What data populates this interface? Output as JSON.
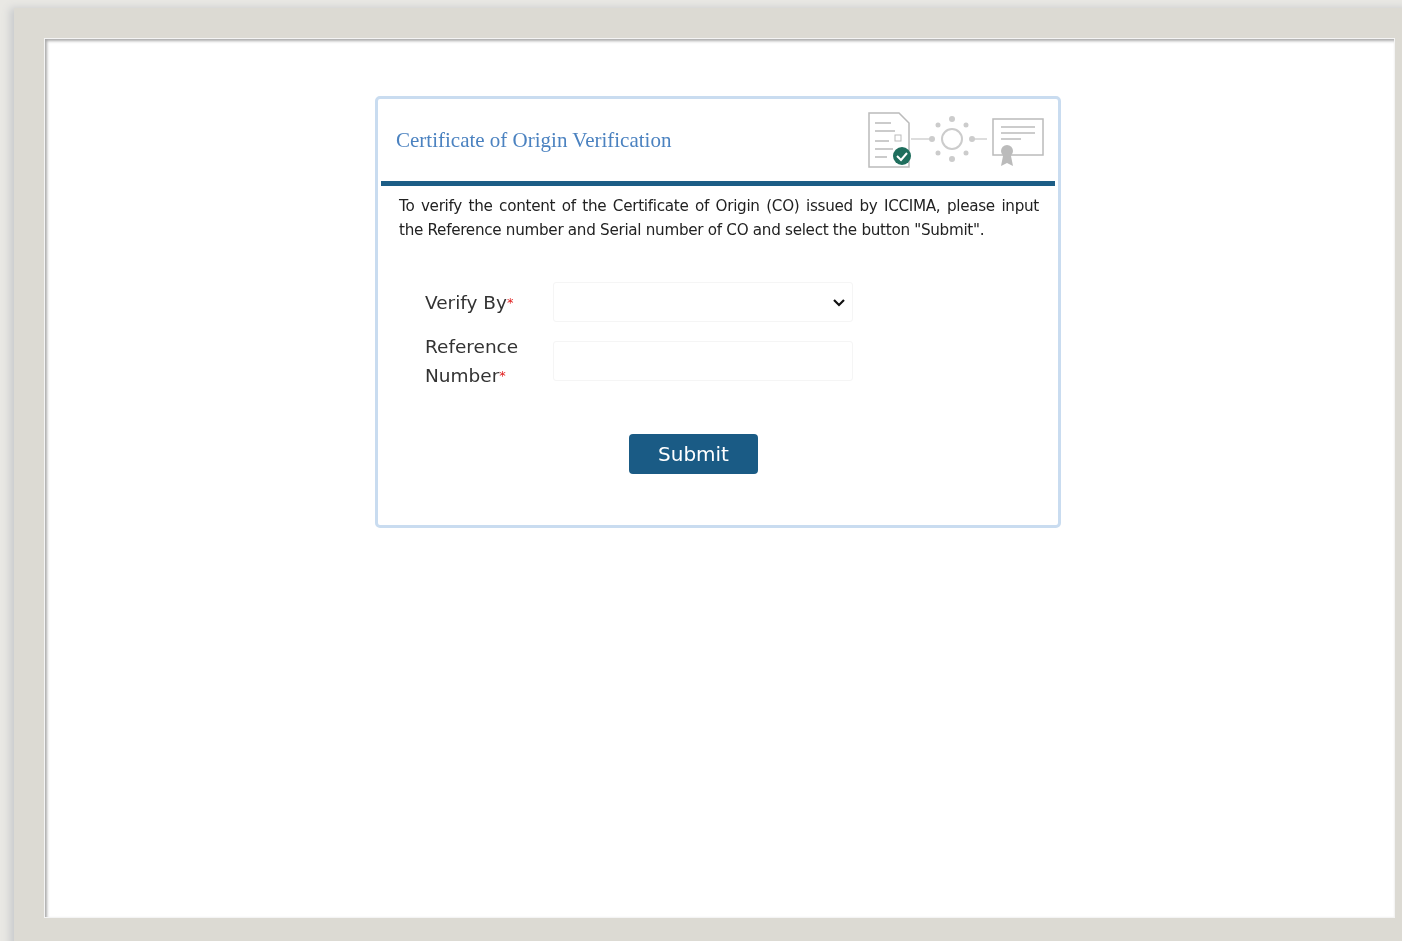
{
  "card": {
    "title": "Certificate of Origin Verification",
    "intro": "To verify the content of the Certificate of Origin (CO) issued by ICCIMA, please input the Reference number and Serial number of CO and select the button \"Submit\".",
    "fields": [
      {
        "kind": "select",
        "label": "Verify By",
        "required_mark": "*"
      },
      {
        "kind": "text",
        "label": "Reference Number",
        "required_mark": "*"
      }
    ],
    "submit": "Submit"
  }
}
